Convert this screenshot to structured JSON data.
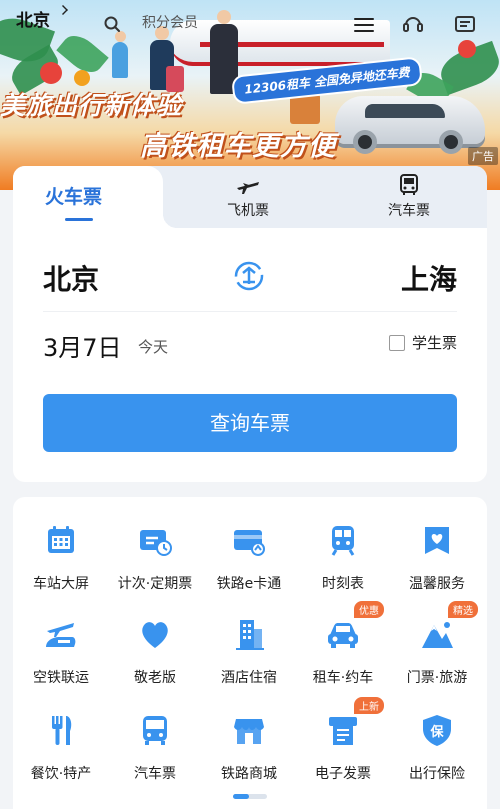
{
  "header": {
    "city": "北京",
    "search_text": "积分会员"
  },
  "banner": {
    "slogan_line1": "美旅出行新体验",
    "slogan_line2": "高铁租车更方便",
    "promo": "12306租车 全国免异地还车费",
    "ad_label": "广告"
  },
  "tabs": [
    {
      "label": "火车票",
      "active": true
    },
    {
      "label": "飞机票",
      "icon": "airplane-icon"
    },
    {
      "label": "汽车票",
      "icon": "bus-icon"
    }
  ],
  "ticket": {
    "from": "北京",
    "to": "上海",
    "date": "3月7日",
    "date_sub": "今天",
    "student_label": "学生票",
    "search_button": "查询车票"
  },
  "services": [
    {
      "label": "车站大屏",
      "icon": "calendar-icon"
    },
    {
      "label": "计次·定期票",
      "icon": "ticket-clock-icon"
    },
    {
      "label": "铁路e卡通",
      "icon": "rail-card-icon"
    },
    {
      "label": "时刻表",
      "icon": "train-icon"
    },
    {
      "label": "温馨服务",
      "icon": "heart-bag-icon"
    },
    {
      "label": "空铁联运",
      "icon": "plane-train-icon"
    },
    {
      "label": "敬老版",
      "icon": "heart-icon"
    },
    {
      "label": "酒店住宿",
      "icon": "building-icon"
    },
    {
      "label": "租车·约车",
      "icon": "car-icon",
      "badge": "优惠"
    },
    {
      "label": "门票·旅游",
      "icon": "mountain-icon",
      "badge": "精选"
    },
    {
      "label": "餐饮·特产",
      "icon": "fork-knife-icon"
    },
    {
      "label": "汽车票",
      "icon": "bus-front-icon"
    },
    {
      "label": "铁路商城",
      "icon": "shop-icon"
    },
    {
      "label": "电子发票",
      "icon": "invoice-icon",
      "badge": "上新"
    },
    {
      "label": "出行保险",
      "icon": "shield-icon"
    }
  ],
  "colors": {
    "accent": "#2a73d9",
    "button": "#3993ee",
    "icon": "#3993ee",
    "badge": "#f0703a"
  }
}
